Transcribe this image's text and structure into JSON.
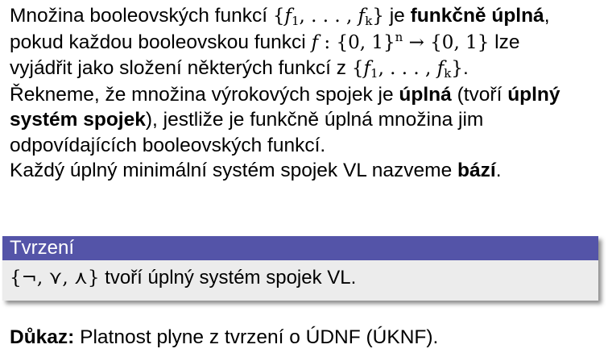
{
  "definition": {
    "l1_a": "Množina booleovských funkcí ",
    "l1_m_open": "{",
    "l1_m_f1": "f",
    "l1_m_s1": "1",
    "l1_m_mid": ", . . . , ",
    "l1_m_fk": "f",
    "l1_m_sk": "k",
    "l1_m_close": "}",
    "l1_b": " je ",
    "l1_bold": "funkčně úplná",
    "l1_c": ",",
    "l2_a": "pokud každou booleovskou funkci ",
    "l2_m_f": "f",
    "l2_m_a": " : {0, 1}",
    "l2_m_n": "n",
    "l2_m_b": " → {0, 1}",
    "l2_b": " lze",
    "l3_a": "vyjádřit jako složení některých funkcí z ",
    "l3_m_open": "{",
    "l3_m_f1": "f",
    "l3_m_s1": "1",
    "l3_m_mid": ", . . . , ",
    "l3_m_fk": "f",
    "l3_m_sk": "k",
    "l3_m_close": "}",
    "l3_b": ".",
    "l4_a": "Řekneme, že množina výrokových spojek je ",
    "l4_bold": "úplná",
    "l4_b": " (tvoří ",
    "l4_bold2": "úplný",
    "l5_bold": "systém spojek",
    "l5_a": "), jestliže je funkčně úplná množina jim",
    "l6_a": "odpovídajících booleovských funkcí.",
    "l7_a": "Každý úplný minimální systém spojek VL nazveme ",
    "l7_bold": "bází",
    "l7_b": "."
  },
  "theorem": {
    "title": "Tvrzení",
    "math": "{¬, ⋎, ⋏}",
    "text": " tvoří úplný systém spojek VL."
  },
  "proof": {
    "label": "Důkaz:",
    "text": " Platnost plyne z tvrzení o ÚDNF (ÚKNF)."
  },
  "colors": {
    "block_title_bg": "#5454a8",
    "block_body_bg": "#ececec"
  }
}
